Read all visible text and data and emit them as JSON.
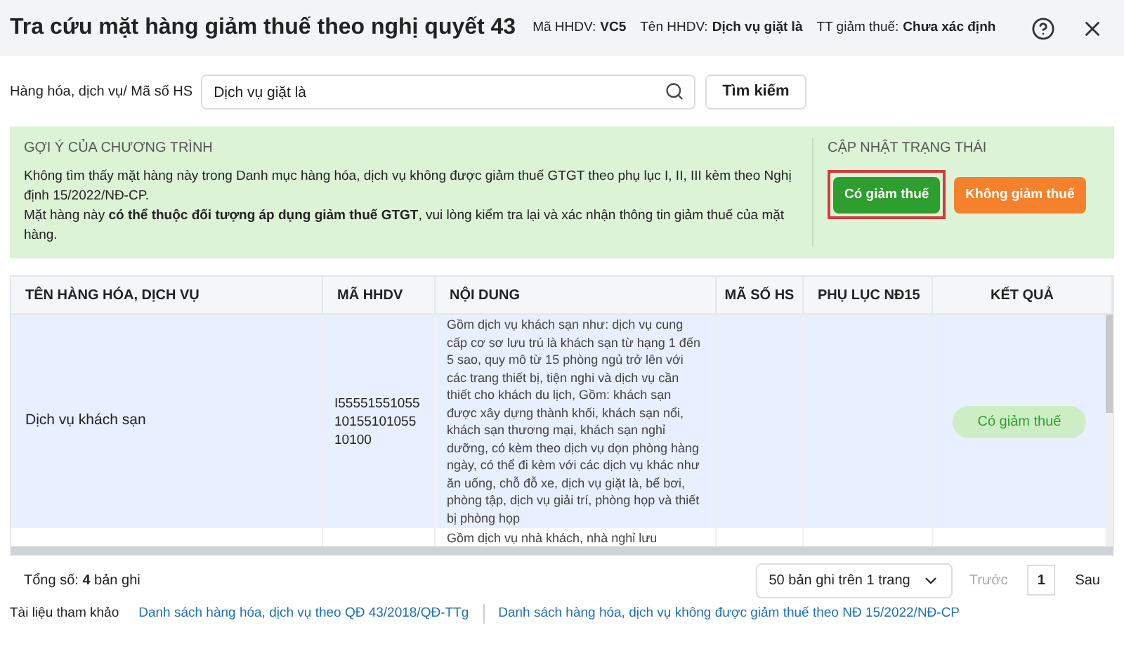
{
  "window": {
    "title": "Tra cứu mặt hàng giảm thuế theo nghị quyết 43"
  },
  "header_info": [
    {
      "label": "Mã HHDV:",
      "value": "VC5"
    },
    {
      "label": "Tên HHDV:",
      "value": "Dịch vụ giặt là"
    },
    {
      "label": "TT giảm thuế:",
      "value": "Chưa xác định"
    }
  ],
  "search": {
    "label": "Hàng hóa, dịch vụ/ Mã số HS",
    "value": "Dịch vụ giặt là",
    "button": "Tìm kiếm"
  },
  "suggestion": {
    "title": "GỢI Ý CỦA CHƯƠNG TRÌNH",
    "lines": [
      "Không tìm thấy mặt hàng này trong Danh mục hàng hóa, dịch vụ không được giảm thuế GTGT theo phụ lục I, II, III kèm theo Nghị định 15/2022/NĐ-CP.",
      "Mặt hàng này **có thể thuộc đối tượng áp dụng giảm thuế GTGT**, vui lòng kiểm tra lại và xác nhận thông tin giảm thuế của mặt hàng."
    ]
  },
  "status_update": {
    "title": "CẬP NHẬT TRẠNG THÁI",
    "buttons": [
      {
        "label": "Có giảm thuế",
        "color": "#2e9e2e",
        "selected": true
      },
      {
        "label": "Không giảm thuế",
        "color": "#f5812c",
        "selected": false
      }
    ]
  },
  "table": {
    "columns": [
      "TÊN HÀNG HÓA, DỊCH VỤ",
      "MÃ HHDV",
      "NỘI DUNG",
      "MÃ SỐ HS",
      "PHỤ LỤC NĐ15",
      "KẾT QUẢ"
    ],
    "rows": [
      {
        "name": "Dịch vụ khách sạn",
        "code": "I55551551055 10155101055 10100",
        "content": "Gồm dịch vụ khách sạn như: dịch vụ cung cấp cơ sơ lưu trú là khách sạn từ hạng 1 đến 5 sao, quy mô từ 15 phòng ngủ trở lên với các trang thiết bị, tiện nghi và dịch vụ cần thiết cho khách du lịch, Gồm: khách sạn được xây dựng thành khối, khách sạn nổi, khách sạn thương mại, khách sạn nghỉ dưỡng, có kèm theo dịch vụ dọn phòng hàng ngày, có thể đi kèm với các dịch vụ khác như ăn uống, chỗ đỗ xe, dịch vụ giặt là, bể bơi, phòng tập, dịch vụ giải trí, phòng họp và thiết bị phòng họp",
        "result": "Có giảm thuế",
        "selected": true
      },
      {
        "name": "",
        "code": "",
        "content": "Gồm dịch vụ nhà khách, nhà nghỉ lưu",
        "result": "",
        "selected": false
      }
    ]
  },
  "footer": {
    "total": "Tổng số: **4** bản ghi",
    "page_size": "50 bản ghi trên 1 trang",
    "prev": "Trước",
    "page": "1",
    "next": "Sau"
  },
  "references": {
    "label": "Tài liệu tham khảo",
    "links": [
      "Danh sách hàng hóa, dịch vụ theo QĐ 43/2018/QĐ-TTg",
      "Danh sách hàng hóa, dịch vụ không được giảm thuế theo NĐ 15/2022/NĐ-CP"
    ]
  }
}
